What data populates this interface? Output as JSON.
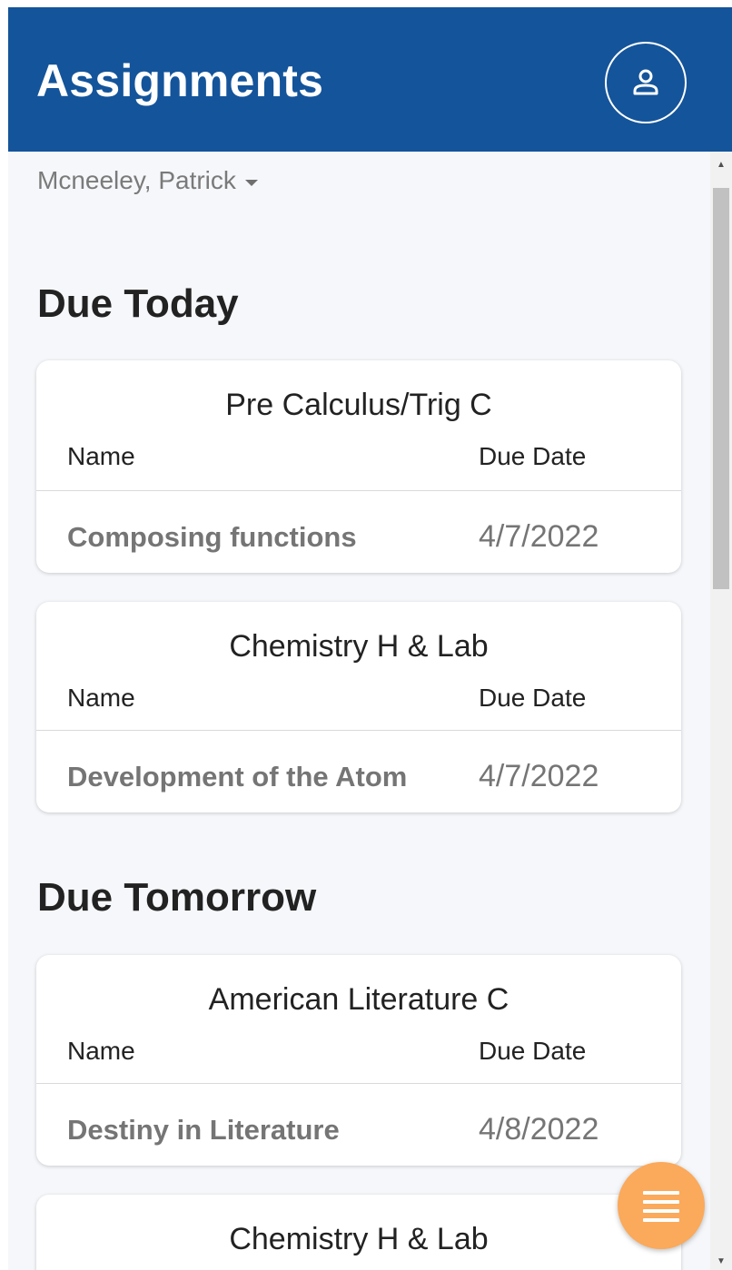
{
  "app": {
    "title": "Assignments",
    "accent": "#14549a",
    "fab_color": "#fba95a"
  },
  "header": {
    "profile_icon": "user-icon"
  },
  "student": {
    "name": "Mcneeley, Patrick"
  },
  "sections": [
    {
      "title": "Due Today",
      "cards": [
        {
          "course": "Pre Calculus/Trig C",
          "name_header": "Name",
          "due_header": "Due Date",
          "assignment": "Composing functions",
          "due": "4/7/2022"
        },
        {
          "course": "Chemistry H & Lab",
          "name_header": "Name",
          "due_header": "Due Date",
          "assignment": "Development of the Atom",
          "due": "4/7/2022"
        }
      ]
    },
    {
      "title": "Due Tomorrow",
      "cards": [
        {
          "course": "American Literature C",
          "name_header": "Name",
          "due_header": "Due Date",
          "assignment": "Destiny in Literature",
          "due": "4/8/2022"
        },
        {
          "course": "Chemistry H & Lab"
        }
      ]
    }
  ],
  "fab": {
    "icon": "menu-icon"
  }
}
